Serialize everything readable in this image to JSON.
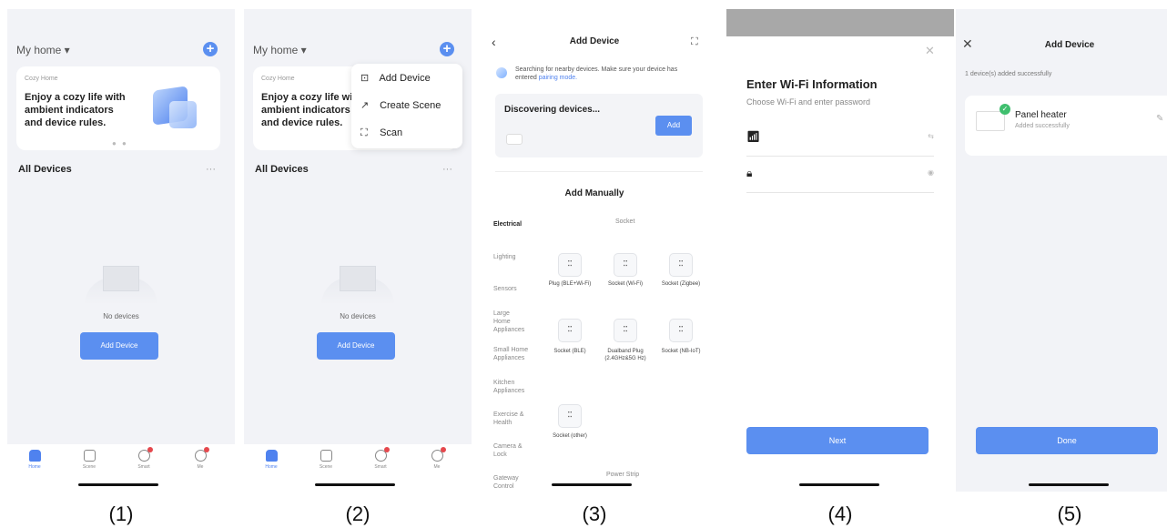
{
  "captions": [
    "(1)",
    "(2)",
    "(3)",
    "(4)",
    "(5)"
  ],
  "home": {
    "title": "My home ▾",
    "card_small": "Cozy Home",
    "card_text_1": "Enjoy a cozy life with",
    "card_text_2": "ambient indicators",
    "card_text_3": "and device rules.",
    "all_devices": "All Devices",
    "more": "···",
    "no_devices": "No devices",
    "add_device_button": "Add Device",
    "tabs": [
      "Home",
      "Scene",
      "Smart",
      "Me"
    ]
  },
  "menu": {
    "items": [
      {
        "label": "Add Device",
        "icon": "add-device-icon"
      },
      {
        "label": "Create Scene",
        "icon": "create-scene-icon"
      },
      {
        "label": "Scan",
        "icon": "scan-icon"
      }
    ]
  },
  "add_device": {
    "title": "Add Device",
    "search_text": "Searching for nearby devices. Make sure your device has entered",
    "pairing_link": "pairing mode.",
    "discovering": "Discovering devices...",
    "add_button": "Add",
    "add_manually": "Add Manually",
    "categories": [
      "Electrical",
      "Lighting",
      "Sensors",
      "Large Home Appliances",
      "Small Home Appliances",
      "Kitchen Appliances",
      "Exercise & Health",
      "Camera & Lock",
      "Gateway Control"
    ],
    "section_socket": "Socket",
    "section_power_strip": "Power Strip",
    "sockets": [
      "Plug (BLE+Wi-Fi)",
      "Socket (Wi-Fi)",
      "Socket (Zigbee)",
      "Socket (BLE)",
      "Dualband Plug (2.4GHz&5G Hz)",
      "Socket (NB-IoT)",
      "Socket (other)"
    ]
  },
  "wifi": {
    "title": "Enter Wi-Fi Information",
    "subtitle": "Choose Wi-Fi and enter password",
    "next_button": "Next"
  },
  "done": {
    "title": "Add Device",
    "success_count": "1 device(s) added successfully",
    "device_name": "Panel heater",
    "device_status": "Added successfully",
    "done_button": "Done"
  },
  "colors": {
    "accent": "#5b8ff0",
    "success": "#3fbf6e",
    "badge": "#e5484d"
  }
}
